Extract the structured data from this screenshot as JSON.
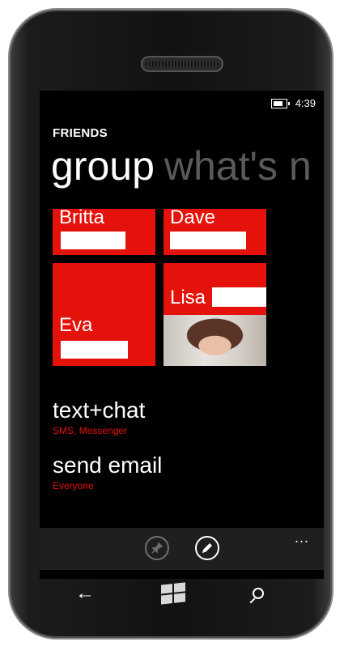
{
  "status": {
    "time": "4:39"
  },
  "app": {
    "title": "FRIENDS"
  },
  "pivot": {
    "active": "group",
    "next": "what's n"
  },
  "tiles": {
    "britta": {
      "name": "Britta"
    },
    "dave": {
      "name": "Dave"
    },
    "eva": {
      "name": "Eva"
    },
    "lisa": {
      "name": "Lisa"
    }
  },
  "actions": {
    "text_chat": {
      "title": "text+chat",
      "subtitle": "SMS, Messenger"
    },
    "send_email": {
      "title": "send email",
      "subtitle": "Everyone"
    }
  },
  "appbar": {
    "pin_icon": "pin-icon",
    "edit_icon": "pencil-icon",
    "more_label": "..."
  },
  "hardware": {
    "back": "←",
    "start": "windows-logo",
    "search": "search-icon"
  },
  "colors": {
    "accent": "#e5120b",
    "background": "#000000",
    "inactive": "#5a5a5a"
  }
}
